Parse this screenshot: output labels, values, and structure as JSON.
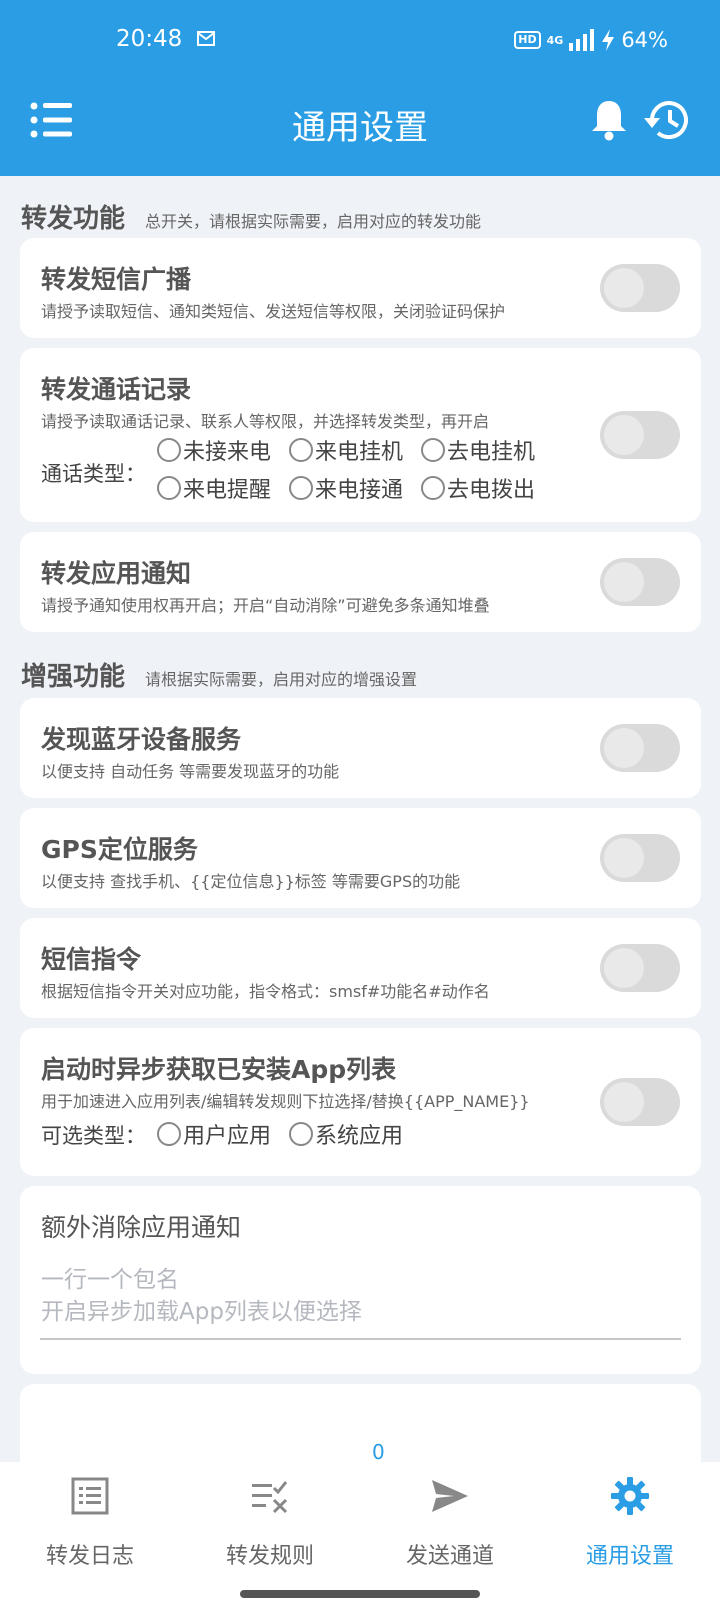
{
  "status_bar": {
    "time": "20:48",
    "network": "4G",
    "battery": "64%"
  },
  "app_bar": {
    "title": "通用设置"
  },
  "sections": [
    {
      "title": "转发功能",
      "desc": "总开关，请根据实际需要，启用对应的转发功能"
    },
    {
      "title": "增强功能",
      "desc": "请根据实际需要，启用对应的增强设置"
    }
  ],
  "cards": {
    "sms": {
      "title": "转发短信广播",
      "desc": "请授予读取短信、通知类短信、发送短信等权限，关闭验证码保护",
      "enabled": false
    },
    "call": {
      "title": "转发通话记录",
      "desc": "请授予读取通话记录、联系人等权限，并选择转发类型，再开启",
      "type_label": "通话类型：",
      "options": [
        "未接来电",
        "来电挂机",
        "去电挂机",
        "来电提醒",
        "来电接通",
        "去电拨出"
      ],
      "enabled": false
    },
    "app_notify": {
      "title": "转发应用通知",
      "desc": "请授予通知使用权再开启；开启“自动消除”可避免多条通知堆叠",
      "enabled": false
    },
    "bluetooth": {
      "title": "发现蓝牙设备服务",
      "desc": "以便支持 自动任务 等需要发现蓝牙的功能",
      "enabled": false
    },
    "gps": {
      "title": "GPS定位服务",
      "desc": "以便支持 查找手机、{{定位信息}}标签 等需要GPS的功能",
      "enabled": false
    },
    "sms_cmd": {
      "title": "短信指令",
      "desc": "根据短信指令开关对应功能，指令格式：smsf#功能名#动作名",
      "enabled": false
    },
    "app_list": {
      "title": "启动时异步获取已安装App列表",
      "desc": "用于加速进入应用列表/编辑转发规则下拉选择/替换{{APP_NAME}}",
      "type_label": "可选类型：",
      "options": [
        "用户应用",
        "系统应用"
      ],
      "enabled": false
    },
    "extra_clear": {
      "title": "额外消除应用通知",
      "hint_line1": "一行一个包名",
      "hint_line2": "开启异步加载App列表以便选择"
    },
    "partial": {
      "counter": "0"
    }
  },
  "bottom_nav": [
    {
      "label": "转发日志",
      "icon": "log-list-icon",
      "active": false
    },
    {
      "label": "转发规则",
      "icon": "rules-icon",
      "active": false
    },
    {
      "label": "发送通道",
      "icon": "send-icon",
      "active": false
    },
    {
      "label": "通用设置",
      "icon": "gear-icon",
      "active": true
    }
  ],
  "colors": {
    "primary": "#2a9de4",
    "background": "#eff2f7",
    "toggle_off": "#dadada"
  }
}
